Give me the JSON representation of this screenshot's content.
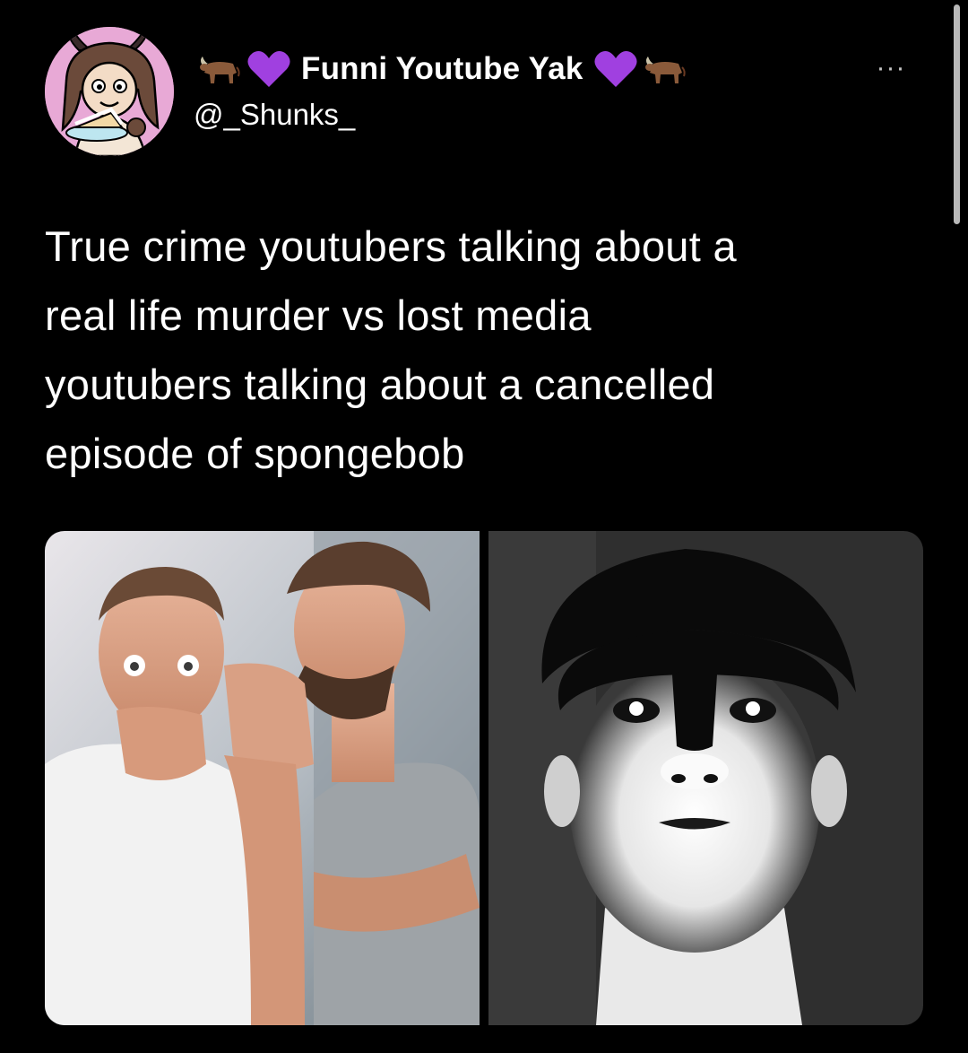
{
  "tweet": {
    "display_name": "Funni Youtube Yak",
    "handle": "@_Shunks_",
    "name_emojis": [
      "ox-icon",
      "purple-heart-icon",
      "purple-heart-icon",
      "ox-icon"
    ],
    "more_label": "···",
    "text": "True crime youtubers talking about a\nreal life murder vs lost media\nyoutubers talking about a cancelled\nepisode of spongebob",
    "media": [
      {
        "name": "photo-whispering-men",
        "description_icon": "photo"
      },
      {
        "name": "photo-lit-face",
        "description_icon": "photo"
      }
    ]
  },
  "colors": {
    "background": "#000000",
    "text": "#ffffff",
    "heart": "#a040e0",
    "avatar_bg": "#e8a9d6"
  }
}
